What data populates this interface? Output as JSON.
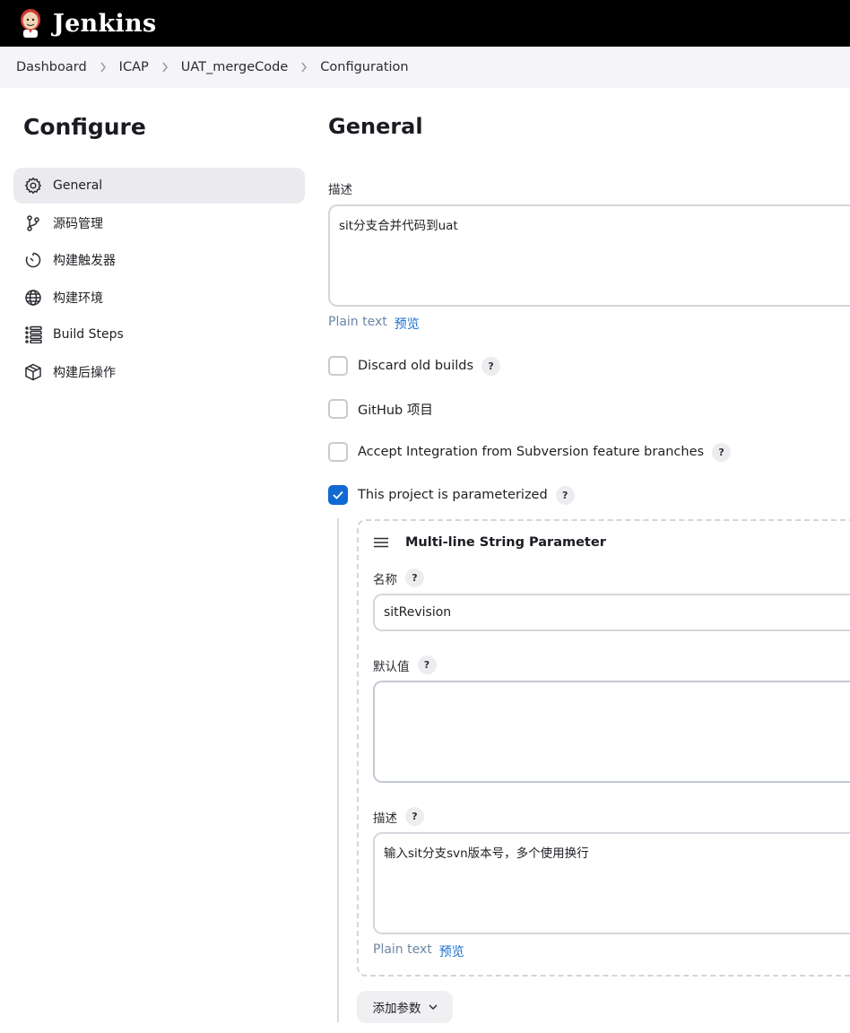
{
  "header": {
    "brand": "Jenkins",
    "logo_icon": "jenkins-butler-logo"
  },
  "breadcrumb": [
    "Dashboard",
    "ICAP",
    "UAT_mergeCode",
    "Configuration"
  ],
  "sidebar": {
    "title": "Configure",
    "items": [
      {
        "label": "General",
        "icon": "gear-icon",
        "active": true
      },
      {
        "label": "源码管理",
        "icon": "branch-icon"
      },
      {
        "label": "构建触发器",
        "icon": "timer-icon"
      },
      {
        "label": "构建环境",
        "icon": "globe-icon"
      },
      {
        "label": "Build Steps",
        "icon": "list-icon"
      },
      {
        "label": "构建后操作",
        "icon": "package-icon"
      }
    ]
  },
  "main": {
    "title": "General",
    "description_label": "描述",
    "description_value": "sit分支合并代码到uat",
    "plain_text_link": "Plain text",
    "preview_link": "预览",
    "help_symbol": "?",
    "options": [
      {
        "label": "Discard old builds",
        "checked": false,
        "help": true
      },
      {
        "label": "GitHub 项目",
        "checked": false,
        "help": false
      },
      {
        "label": "Accept Integration from Subversion feature branches",
        "checked": false,
        "help": true
      },
      {
        "label": "This project is parameterized",
        "checked": true,
        "help": true
      }
    ],
    "parameter": {
      "type_title": "Multi-line String Parameter",
      "name_label": "名称",
      "name_value": "sitRevision",
      "default_label": "默认值",
      "default_value": "",
      "description_label": "描述",
      "description_value": "输入sit分支svn版本号，多个使用换行",
      "plain_text_link": "Plain text",
      "preview_link": "预览"
    },
    "add_parameter_label": "添加参数"
  },
  "colors": {
    "accent": "#1269d4",
    "topbar": "#000000",
    "breadcrumb_bg": "#f5f5f7",
    "link": "#1a6fcf",
    "muted_link": "#6d86a6"
  }
}
